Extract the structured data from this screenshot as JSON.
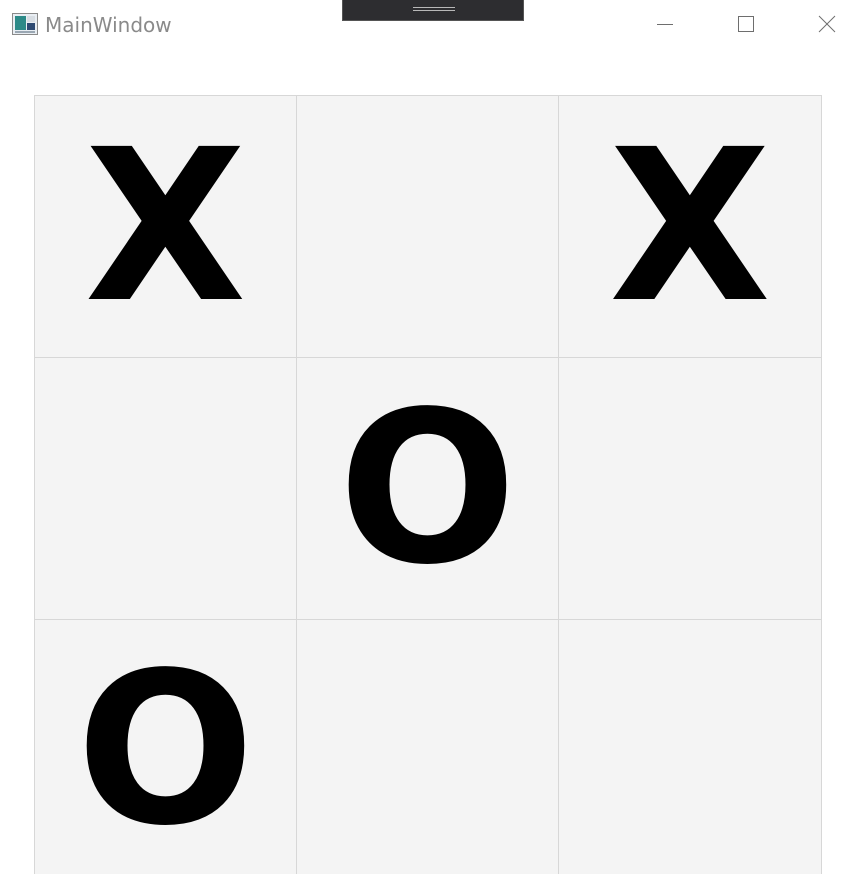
{
  "window": {
    "title": "MainWindow"
  },
  "icons": {
    "app": "app-window-icon",
    "minimize": "minimize-icon",
    "maximize": "maximize-icon",
    "close": "close-icon"
  },
  "board": {
    "cells": [
      "X",
      "",
      "X",
      "",
      "O",
      "",
      "O",
      "",
      ""
    ]
  },
  "colors": {
    "cell_background": "#f4f4f4",
    "cell_border": "#d7d7d7",
    "mark": "#000000",
    "title_text": "#8a8a8a"
  }
}
